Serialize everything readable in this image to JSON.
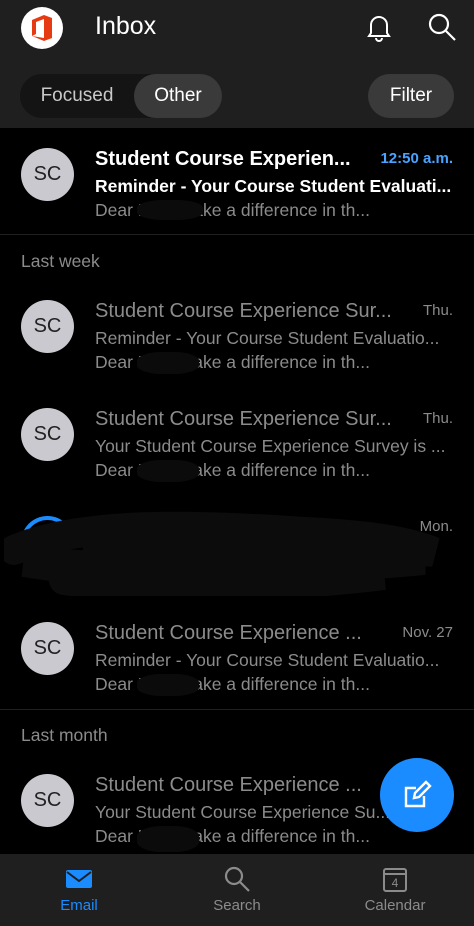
{
  "header": {
    "title": "Inbox"
  },
  "tabs": {
    "focused": "Focused",
    "other": "Other",
    "filter": "Filter"
  },
  "sections": {
    "last_week": "Last week",
    "last_month": "Last month"
  },
  "emails": [
    {
      "avatar": "SC",
      "sender": "Student Course Experien...",
      "subject": "Reminder - Your Course Student Evaluati...",
      "preview": "Dear        Help make a difference in th...",
      "time": "12:50 a.m."
    },
    {
      "avatar": "SC",
      "sender": "Student Course Experience Sur...",
      "subject": "Reminder - Your Course Student Evaluatio...",
      "preview": "Dear        Help make a difference in th...",
      "time": "Thu."
    },
    {
      "avatar": "SC",
      "sender": "Student Course Experience Sur...",
      "subject": "Your Student Course Experience Survey is ...",
      "preview": "Dear        Help make a difference in th...",
      "time": "Thu."
    },
    {
      "avatar": "",
      "sender": "",
      "subject": "",
      "preview": "",
      "time": "Mon."
    },
    {
      "avatar": "SC",
      "sender": "Student Course Experience ...",
      "subject": "Reminder - Your Course Student Evaluatio...",
      "preview": "Dear        Help make a difference in th...",
      "time": "Nov. 27"
    },
    {
      "avatar": "SC",
      "sender": "Student Course Experience ...",
      "subject": "Your Student Course Experience Su...",
      "preview": "Dear        Help make a difference in th...",
      "time": ""
    }
  ],
  "nav": {
    "email": "Email",
    "search": "Search",
    "calendar": "Calendar",
    "calendar_day": "4"
  },
  "colors": {
    "accent": "#1a8cff",
    "unread_time": "#4aa3ff",
    "header_bg": "#1f1f1f"
  }
}
